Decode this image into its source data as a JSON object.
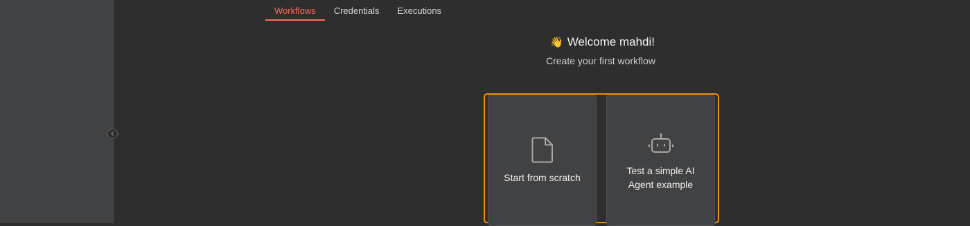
{
  "tabs": [
    {
      "label": "Workflows",
      "active": true
    },
    {
      "label": "Credentials",
      "active": false
    },
    {
      "label": "Executions",
      "active": false
    }
  ],
  "welcome": {
    "emoji": "👋",
    "title": "Welcome mahdi!",
    "subtitle": "Create your first workflow"
  },
  "cards": [
    {
      "label": "Start from scratch",
      "icon": "file-icon"
    },
    {
      "label_line1": "Test a simple AI",
      "label_line2": "Agent example",
      "icon": "robot-icon"
    }
  ],
  "colors": {
    "accent": "#ff6d5a",
    "highlight_border": "#f0900a",
    "background": "#2e2e2e",
    "sidebar": "#414244",
    "card": "#414244"
  },
  "sidebar": {
    "collapse_icon": "chevron-left-icon"
  }
}
